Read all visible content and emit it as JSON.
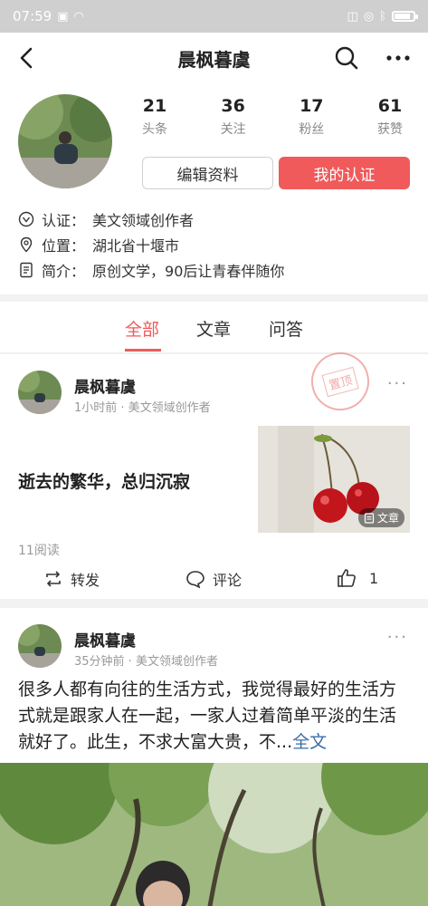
{
  "status_bar": {
    "time": "07:59"
  },
  "nav": {
    "title": "晨枫暮虞"
  },
  "profile": {
    "stats": [
      {
        "num": "21",
        "label": "头条"
      },
      {
        "num": "36",
        "label": "关注"
      },
      {
        "num": "17",
        "label": "粉丝"
      },
      {
        "num": "61",
        "label": "获赞"
      }
    ],
    "edit_label": "编辑资料",
    "cert_label": "我的认证",
    "cert_key": "认证：",
    "cert_value": "美文领域创作者",
    "loc_key": "位置：",
    "loc_value": "湖北省十堰市",
    "bio_key": "简介：",
    "bio_value": "原创文学，90后让青春伴随你"
  },
  "tabs": [
    {
      "label": "全部"
    },
    {
      "label": "文章"
    },
    {
      "label": "问答"
    }
  ],
  "feed": [
    {
      "name": "晨枫暮虞",
      "meta": "1小时前 · 美文领域创作者",
      "stamp": "置顶",
      "title": "逝去的繁华，总归沉寂",
      "thumb_tag": "文章",
      "reads": "11阅读",
      "repost": "转发",
      "comment": "评论",
      "likes": "1"
    },
    {
      "name": "晨枫暮虞",
      "meta": "35分钟前 · 美文领域创作者",
      "text": "很多人都有向往的生活方式，我觉得最好的生活方式就是跟家人在一起，一家人过着简单平淡的生活就好了。此生，不求大富大贵，不...",
      "more": "全文"
    }
  ]
}
